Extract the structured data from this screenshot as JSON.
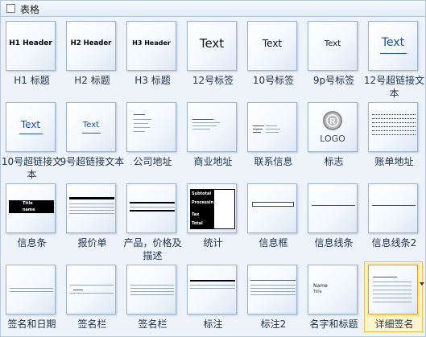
{
  "panel": {
    "title": "表格"
  },
  "shapes": [
    {
      "label": "H1 标题",
      "text": "H1 Header"
    },
    {
      "label": "H2 标题",
      "text": "H2 Header"
    },
    {
      "label": "H3 标题",
      "text": "H3 Header"
    },
    {
      "label": "12号标签",
      "text": "Text"
    },
    {
      "label": "10号标签",
      "text": "Text"
    },
    {
      "label": "9p号标签",
      "text": "Text"
    },
    {
      "label": "12号超链接文本",
      "text": "Text"
    },
    {
      "label": "10号超链接文本",
      "text": "Text"
    },
    {
      "label": "9号超链接文本",
      "text": "Text"
    },
    {
      "label": "公司地址"
    },
    {
      "label": "商业地址"
    },
    {
      "label": "联系信息"
    },
    {
      "label": "标志",
      "text": "LOGO"
    },
    {
      "label": "账单地址"
    },
    {
      "label": "信息条",
      "title": "Title",
      "name": "name"
    },
    {
      "label": "报价单"
    },
    {
      "label": "产品，价格及描述"
    },
    {
      "label": "统计",
      "rows": [
        "Subtotal",
        "Processing fees",
        "Tax",
        "Total"
      ]
    },
    {
      "label": "信息框"
    },
    {
      "label": "信息线条"
    },
    {
      "label": "信息线条2"
    },
    {
      "label": "签名和日期"
    },
    {
      "label": "签名栏"
    },
    {
      "label": "签名栏"
    },
    {
      "label": "标注"
    },
    {
      "label": "标注2"
    },
    {
      "label": "名字和标题",
      "text": "Name",
      "sub": "Title"
    },
    {
      "label": "详细签名"
    }
  ]
}
